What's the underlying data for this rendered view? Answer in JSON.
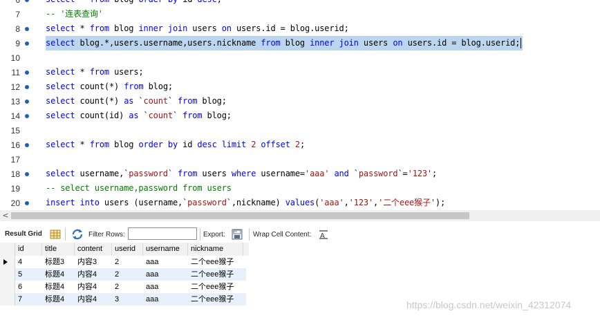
{
  "editor": {
    "lines": [
      {
        "num": "6",
        "dot": true,
        "tokens": [
          [
            "k",
            "select"
          ],
          [
            "t",
            " * "
          ],
          [
            "k",
            "from"
          ],
          [
            "t",
            " blog "
          ],
          [
            "k",
            "order by"
          ],
          [
            "t",
            " id "
          ],
          [
            "k",
            "desc"
          ],
          [
            "t",
            ";"
          ]
        ]
      },
      {
        "num": "7",
        "dot": false,
        "tokens": [
          [
            "c",
            "-- '连表查询'"
          ]
        ]
      },
      {
        "num": "8",
        "dot": true,
        "tokens": [
          [
            "k",
            "select"
          ],
          [
            "t",
            " * "
          ],
          [
            "k",
            "from"
          ],
          [
            "t",
            " blog "
          ],
          [
            "k",
            "inner join"
          ],
          [
            "t",
            " users "
          ],
          [
            "k",
            "on"
          ],
          [
            "t",
            " users.id = blog.userid;"
          ]
        ]
      },
      {
        "num": "9",
        "dot": true,
        "highlight": true,
        "tokens": [
          [
            "k",
            "select"
          ],
          [
            "t",
            " blog.*,users.username,users.nickname "
          ],
          [
            "k",
            "from"
          ],
          [
            "t",
            " blog "
          ],
          [
            "k",
            "inner join"
          ],
          [
            "t",
            " users "
          ],
          [
            "k",
            "on"
          ],
          [
            "t",
            " users.id = blog.userid;"
          ]
        ]
      },
      {
        "num": "10",
        "dot": false,
        "tokens": []
      },
      {
        "num": "11",
        "dot": true,
        "tokens": [
          [
            "k",
            "select"
          ],
          [
            "t",
            " * "
          ],
          [
            "k",
            "from"
          ],
          [
            "t",
            " users;"
          ]
        ]
      },
      {
        "num": "12",
        "dot": true,
        "tokens": [
          [
            "k",
            "select"
          ],
          [
            "t",
            " count(*) "
          ],
          [
            "k",
            "from"
          ],
          [
            "t",
            " blog;"
          ]
        ]
      },
      {
        "num": "13",
        "dot": true,
        "tokens": [
          [
            "k",
            "select"
          ],
          [
            "t",
            " count(*) "
          ],
          [
            "k",
            "as"
          ],
          [
            "t",
            " `"
          ],
          [
            "s",
            "count"
          ],
          [
            "t",
            "` "
          ],
          [
            "k",
            "from"
          ],
          [
            "t",
            " blog;"
          ]
        ]
      },
      {
        "num": "14",
        "dot": true,
        "tokens": [
          [
            "k",
            "select"
          ],
          [
            "t",
            " count(id) "
          ],
          [
            "k",
            "as"
          ],
          [
            "t",
            " `"
          ],
          [
            "s",
            "count"
          ],
          [
            "t",
            "` "
          ],
          [
            "k",
            "from"
          ],
          [
            "t",
            " blog;"
          ]
        ]
      },
      {
        "num": "15",
        "dot": false,
        "tokens": []
      },
      {
        "num": "16",
        "dot": true,
        "tokens": [
          [
            "k",
            "select"
          ],
          [
            "t",
            " * "
          ],
          [
            "k",
            "from"
          ],
          [
            "t",
            " blog "
          ],
          [
            "k",
            "order by"
          ],
          [
            "t",
            " id "
          ],
          [
            "k",
            "desc limit"
          ],
          [
            "t",
            " "
          ],
          [
            "s",
            "2"
          ],
          [
            "t",
            " "
          ],
          [
            "k",
            "offset"
          ],
          [
            "t",
            " "
          ],
          [
            "s",
            "2"
          ],
          [
            "t",
            ";"
          ]
        ]
      },
      {
        "num": "17",
        "dot": false,
        "tokens": []
      },
      {
        "num": "18",
        "dot": true,
        "tokens": [
          [
            "k",
            "select"
          ],
          [
            "t",
            " username,`"
          ],
          [
            "s",
            "password"
          ],
          [
            "t",
            "` "
          ],
          [
            "k",
            "from"
          ],
          [
            "t",
            " users "
          ],
          [
            "k",
            "where"
          ],
          [
            "t",
            " username="
          ],
          [
            "s",
            "'aaa'"
          ],
          [
            "t",
            " "
          ],
          [
            "k",
            "and"
          ],
          [
            "t",
            " `"
          ],
          [
            "s",
            "password"
          ],
          [
            "t",
            "`="
          ],
          [
            "s",
            "'123'"
          ],
          [
            "t",
            ";"
          ]
        ]
      },
      {
        "num": "19",
        "dot": false,
        "tokens": [
          [
            "c",
            "-- select username,password from users"
          ]
        ]
      },
      {
        "num": "20",
        "dot": true,
        "tokens": [
          [
            "k",
            "insert into"
          ],
          [
            "t",
            " users (username,`"
          ],
          [
            "s",
            "password"
          ],
          [
            "t",
            "`,nickname) "
          ],
          [
            "k",
            "values"
          ],
          [
            "t",
            "("
          ],
          [
            "s",
            "'aaa'"
          ],
          [
            "t",
            ","
          ],
          [
            "s",
            "'123'"
          ],
          [
            "t",
            ","
          ],
          [
            "s",
            "'二个eee猴子'"
          ],
          [
            "t",
            ");"
          ]
        ]
      }
    ]
  },
  "scrollbar": {
    "left_arrow": "<"
  },
  "toolbar": {
    "result_grid": "Result Grid",
    "filter_rows": "Filter Rows:",
    "filter_value": "",
    "export": "Export:",
    "wrap_cell": "Wrap Cell Content:",
    "icons": [
      "grid-icon",
      "refresh-icon",
      "export-icon",
      "wrap-icon"
    ]
  },
  "grid": {
    "columns": [
      "id",
      "title",
      "content",
      "userid",
      "username",
      "nickname"
    ],
    "rows": [
      [
        "4",
        "标题3",
        "内容3",
        "2",
        "aaa",
        "二个eee猴子"
      ],
      [
        "5",
        "标题4",
        "内容4",
        "2",
        "aaa",
        "二个eee猴子"
      ],
      [
        "6",
        "标题4",
        "内容4",
        "2",
        "aaa",
        "二个eee猴子"
      ],
      [
        "7",
        "标题4",
        "内容4",
        "3",
        "aaa",
        "二个eee猴子"
      ]
    ],
    "current_row": 0
  },
  "watermark": "https://blog.csdn.net/weixin_42312074",
  "colors": {
    "keyword": "#0000ff",
    "string": "#a31515",
    "comment": "#008000",
    "selection": "#bcd6ef",
    "odd_row": "#e8f0fb"
  }
}
